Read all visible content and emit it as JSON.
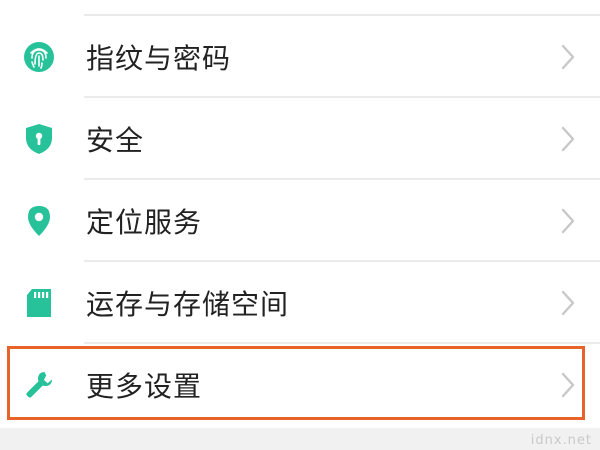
{
  "settings": {
    "items": [
      {
        "label": "指纹与密码",
        "icon": "fingerprint-icon",
        "highlighted": false
      },
      {
        "label": "安全",
        "icon": "shield-icon",
        "highlighted": false
      },
      {
        "label": "定位服务",
        "icon": "location-pin-icon",
        "highlighted": false
      },
      {
        "label": "运存与存储空间",
        "icon": "sd-card-icon",
        "highlighted": false
      },
      {
        "label": "更多设置",
        "icon": "wrench-icon",
        "highlighted": true
      }
    ]
  },
  "watermark": "idnx.net",
  "colors": {
    "icon": "#27c29a",
    "chevron": "#c8c8c8",
    "highlight": "#e8632a",
    "text": "#222222"
  }
}
